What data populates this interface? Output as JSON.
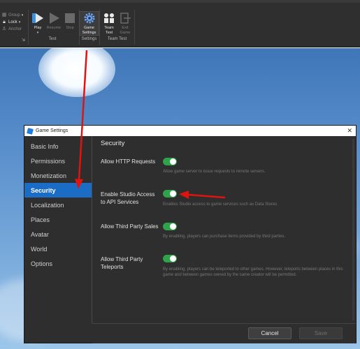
{
  "ribbon": {
    "group_label": "Group",
    "lock_label": "Lock",
    "anchor_label": "Anchor",
    "play_label": "Play",
    "resume_label": "Resume",
    "stop_label": "Stop",
    "game_settings_label_1": "Game",
    "game_settings_label_2": "Settings",
    "team_test_label_1": "Team",
    "team_test_label_2": "Test",
    "exit_game_label_1": "Exit",
    "exit_game_label_2": "Game",
    "group_test": "Test",
    "group_settings": "Settings",
    "group_team_test": "Team Test"
  },
  "dialog": {
    "title": "Game Settings",
    "close_glyph": "✕",
    "sidebar": [
      {
        "label": "Basic Info"
      },
      {
        "label": "Permissions"
      },
      {
        "label": "Monetization"
      },
      {
        "label": "Security",
        "selected": true
      },
      {
        "label": "Localization"
      },
      {
        "label": "Places"
      },
      {
        "label": "Avatar"
      },
      {
        "label": "World"
      },
      {
        "label": "Options"
      }
    ],
    "heading": "Security",
    "settings": [
      {
        "label_1": "Allow HTTP Requests",
        "label_2": "",
        "enabled": true,
        "description": "Allow game server to issue requests to remote servers."
      },
      {
        "label_1": "Enable Studio Access",
        "label_2": "to API Services",
        "enabled": true,
        "description": "Enables Studio access to game services such as Data Stores"
      },
      {
        "label_1": "Allow Third Party Sales",
        "label_2": "",
        "enabled": true,
        "description": "By enabling, players can purchase items provided by third parties."
      },
      {
        "label_1": "Allow Third Party",
        "label_2": "Teleports",
        "enabled": true,
        "description": "By enabling, players can be teleported to other games. However, teleports between places in this game and between games owned by the same creator will be permitted."
      }
    ],
    "cancel_label": "Cancel",
    "save_label": "Save"
  },
  "colors": {
    "toggle_on": "#2ea34a",
    "selected_bg": "#1b6cc4",
    "annotation_arrow": "#e0140f"
  },
  "icons": [
    "group-icon",
    "lock-icon",
    "anchor-icon",
    "play-icon",
    "resume-icon",
    "stop-icon",
    "gear-icon",
    "team-test-icon",
    "exit-game-icon",
    "roblox-logo-icon",
    "close-icon"
  ]
}
